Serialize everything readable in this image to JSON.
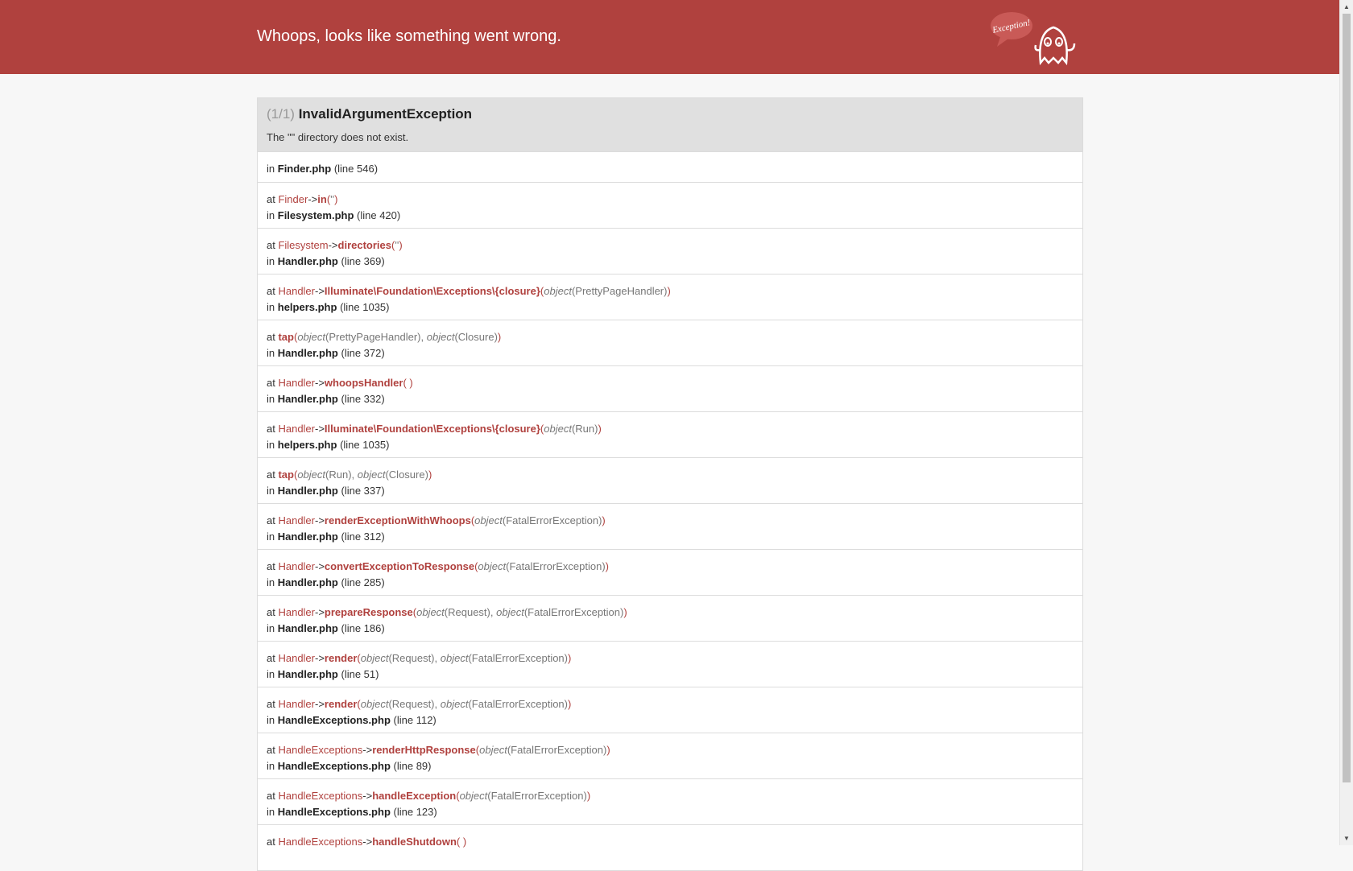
{
  "header": {
    "title": "Whoops, looks like something went wrong.",
    "logo_text": "Exception!"
  },
  "exception": {
    "count": "(1/1)",
    "name": "InvalidArgumentException",
    "message": "The \"\" directory does not exist."
  },
  "first_frame": {
    "prefix": "in",
    "file": "Finder.php",
    "line": "(line 546)"
  },
  "frames": [
    {
      "cls": "Finder",
      "arrow": "->",
      "fn": "in",
      "open": "(",
      "args": [
        {
          "text": "''"
        }
      ],
      "close": ")",
      "file": "Filesystem.php",
      "line": "(line 420)"
    },
    {
      "cls": "Filesystem",
      "arrow": "->",
      "fn": "directories",
      "open": "(",
      "args": [
        {
          "text": "''"
        }
      ],
      "close": ")",
      "file": "Handler.php",
      "line": "(line 369)"
    },
    {
      "cls": "Handler",
      "arrow": "->",
      "fn": "Illuminate\\Foundation\\Exceptions\\{closure}",
      "open": "(",
      "args": [
        {
          "obj": "object",
          "text": "(PrettyPageHandler)"
        }
      ],
      "close": ")",
      "file": "helpers.php",
      "line": "(line 1035)"
    },
    {
      "cls": "",
      "arrow": "",
      "fn": "tap",
      "open": "(",
      "args": [
        {
          "obj": "object",
          "text": "(PrettyPageHandler)"
        },
        {
          "obj": "object",
          "text": "(Closure)"
        }
      ],
      "close": ")",
      "file": "Handler.php",
      "line": "(line 372)"
    },
    {
      "cls": "Handler",
      "arrow": "->",
      "fn": "whoopsHandler",
      "open": "(",
      "args": [],
      "close": ")",
      "file": "Handler.php",
      "line": "(line 332)"
    },
    {
      "cls": "Handler",
      "arrow": "->",
      "fn": "Illuminate\\Foundation\\Exceptions\\{closure}",
      "open": "(",
      "args": [
        {
          "obj": "object",
          "text": "(Run)"
        }
      ],
      "close": ")",
      "file": "helpers.php",
      "line": "(line 1035)"
    },
    {
      "cls": "",
      "arrow": "",
      "fn": "tap",
      "open": "(",
      "args": [
        {
          "obj": "object",
          "text": "(Run)"
        },
        {
          "obj": "object",
          "text": "(Closure)"
        }
      ],
      "close": ")",
      "file": "Handler.php",
      "line": "(line 337)"
    },
    {
      "cls": "Handler",
      "arrow": "->",
      "fn": "renderExceptionWithWhoops",
      "open": "(",
      "args": [
        {
          "obj": "object",
          "text": "(FatalErrorException)"
        }
      ],
      "close": ")",
      "file": "Handler.php",
      "line": "(line 312)"
    },
    {
      "cls": "Handler",
      "arrow": "->",
      "fn": "convertExceptionToResponse",
      "open": "(",
      "args": [
        {
          "obj": "object",
          "text": "(FatalErrorException)"
        }
      ],
      "close": ")",
      "file": "Handler.php",
      "line": "(line 285)"
    },
    {
      "cls": "Handler",
      "arrow": "->",
      "fn": "prepareResponse",
      "open": "(",
      "args": [
        {
          "obj": "object",
          "text": "(Request)"
        },
        {
          "obj": "object",
          "text": "(FatalErrorException)"
        }
      ],
      "close": ")",
      "file": "Handler.php",
      "line": "(line 186)"
    },
    {
      "cls": "Handler",
      "arrow": "->",
      "fn": "render",
      "open": "(",
      "args": [
        {
          "obj": "object",
          "text": "(Request)"
        },
        {
          "obj": "object",
          "text": "(FatalErrorException)"
        }
      ],
      "close": ")",
      "file": "Handler.php",
      "line": "(line 51)"
    },
    {
      "cls": "Handler",
      "arrow": "->",
      "fn": "render",
      "open": "(",
      "args": [
        {
          "obj": "object",
          "text": "(Request)"
        },
        {
          "obj": "object",
          "text": "(FatalErrorException)"
        }
      ],
      "close": ")",
      "file": "HandleExceptions.php",
      "line": "(line 112)"
    },
    {
      "cls": "HandleExceptions",
      "arrow": "->",
      "fn": "renderHttpResponse",
      "open": "(",
      "args": [
        {
          "obj": "object",
          "text": "(FatalErrorException)"
        }
      ],
      "close": ")",
      "file": "HandleExceptions.php",
      "line": "(line 89)"
    },
    {
      "cls": "HandleExceptions",
      "arrow": "->",
      "fn": "handleException",
      "open": "(",
      "args": [
        {
          "obj": "object",
          "text": "(FatalErrorException)"
        }
      ],
      "close": ")",
      "file": "HandleExceptions.php",
      "line": "(line 123)"
    },
    {
      "cls": "HandleExceptions",
      "arrow": "->",
      "fn": "handleShutdown",
      "open": "(",
      "args": [],
      "close": ")",
      "file": "",
      "line": ""
    }
  ],
  "labels": {
    "at": "at",
    "in": "in"
  },
  "colors": {
    "header_bg": "#b0413e",
    "accent": "#b0413e",
    "panel_head_bg": "#e0e0e0"
  },
  "icons": {
    "logo": "whoops-ghost-logo",
    "scroll_up": "scroll-up-arrow",
    "scroll_down": "scroll-down-arrow"
  }
}
